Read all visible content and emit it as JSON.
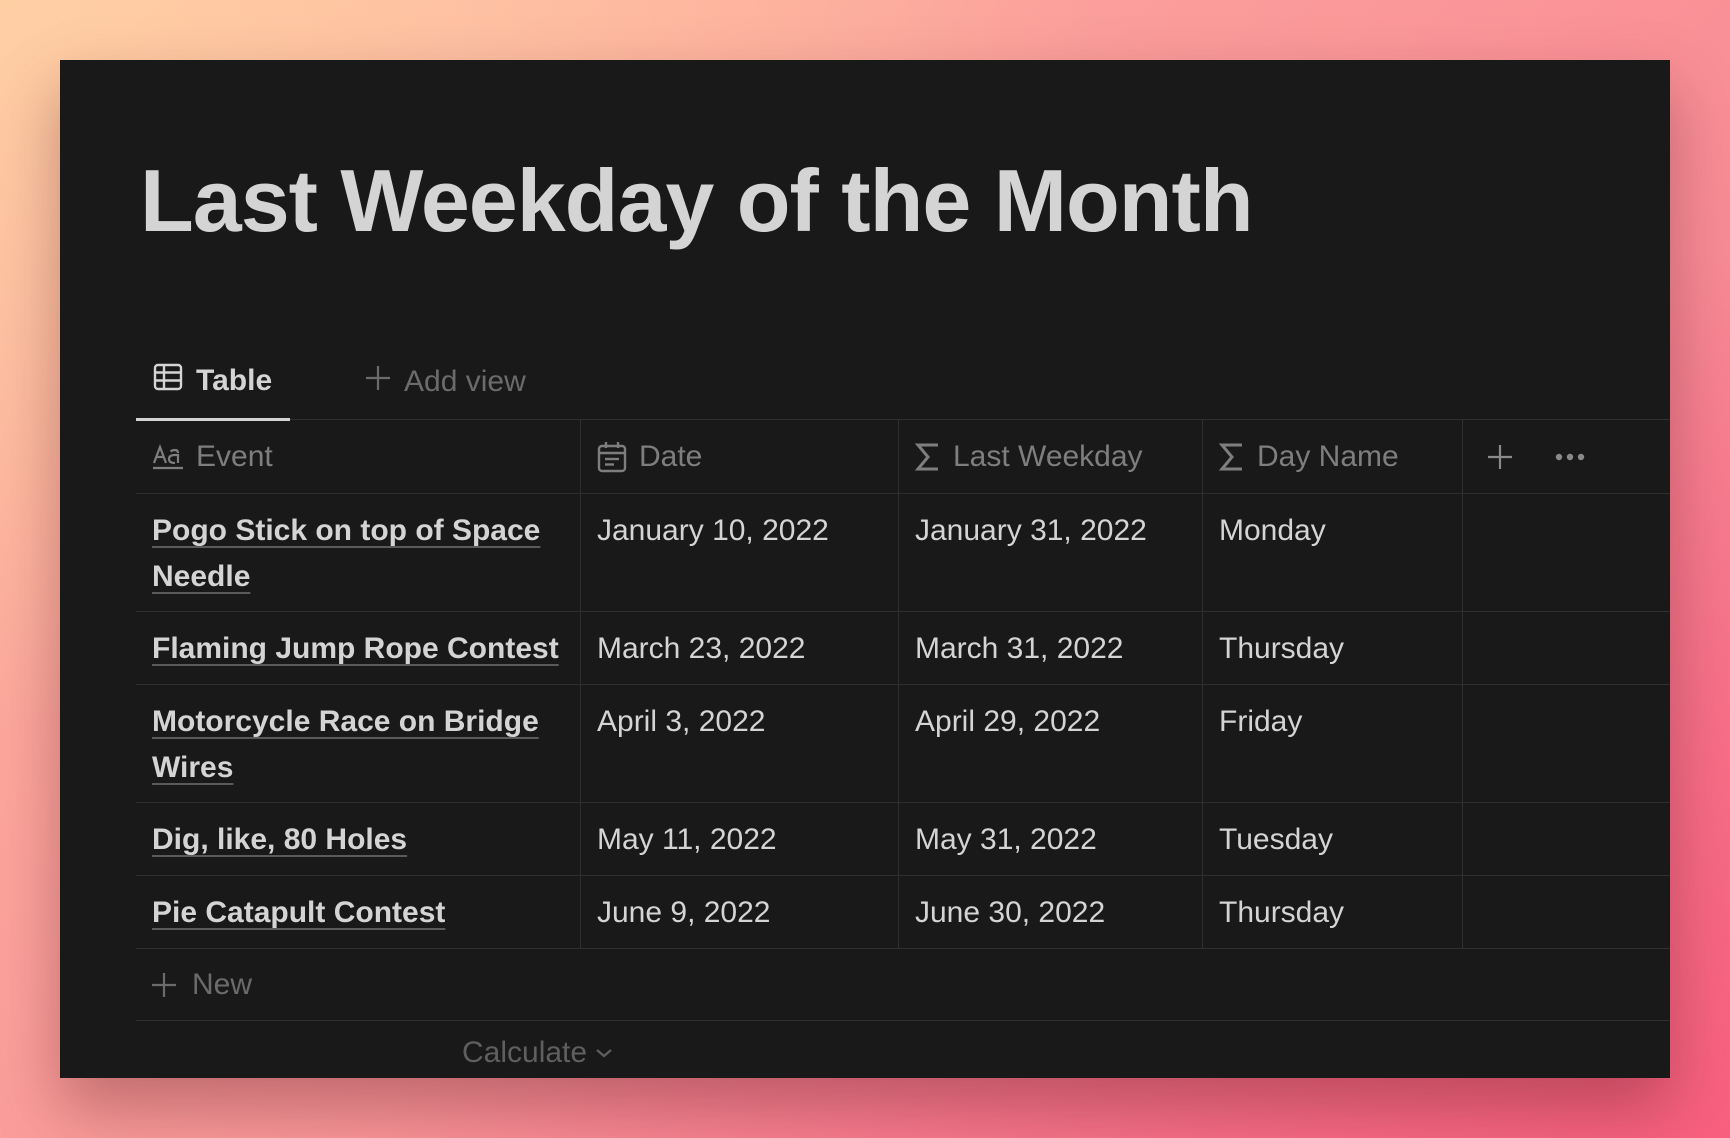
{
  "page": {
    "title": "Last Weekday of the Month"
  },
  "views": {
    "active_tab_label": "Table",
    "add_view_label": "Add view"
  },
  "table": {
    "columns": [
      {
        "label": "Event",
        "icon": "text-icon"
      },
      {
        "label": "Date",
        "icon": "calendar-icon"
      },
      {
        "label": "Last Weekday",
        "icon": "sigma-icon"
      },
      {
        "label": "Day Name",
        "icon": "sigma-icon"
      }
    ],
    "rows": [
      {
        "event": "Pogo Stick on top of Space Needle",
        "date": "January 10, 2022",
        "last_weekday": "January 31, 2022",
        "day_name": "Monday"
      },
      {
        "event": "Flaming Jump Rope Contest",
        "date": "March 23, 2022",
        "last_weekday": "March 31, 2022",
        "day_name": "Thursday"
      },
      {
        "event": "Motorcycle Race on Bridge Wires",
        "date": "April 3, 2022",
        "last_weekday": "April 29, 2022",
        "day_name": "Friday"
      },
      {
        "event": "Dig, like, 80 Holes",
        "date": "May 11, 2022",
        "last_weekday": "May 31, 2022",
        "day_name": "Tuesday"
      },
      {
        "event": "Pie Catapult Contest",
        "date": "June 9, 2022",
        "last_weekday": "June 30, 2022",
        "day_name": "Thursday"
      }
    ],
    "new_row_label": "New",
    "calculate_label": "Calculate"
  },
  "colors": {
    "background": "#191919",
    "text": "#d4d4d4",
    "muted": "#7e7e7e",
    "border": "#2f2f2f"
  }
}
